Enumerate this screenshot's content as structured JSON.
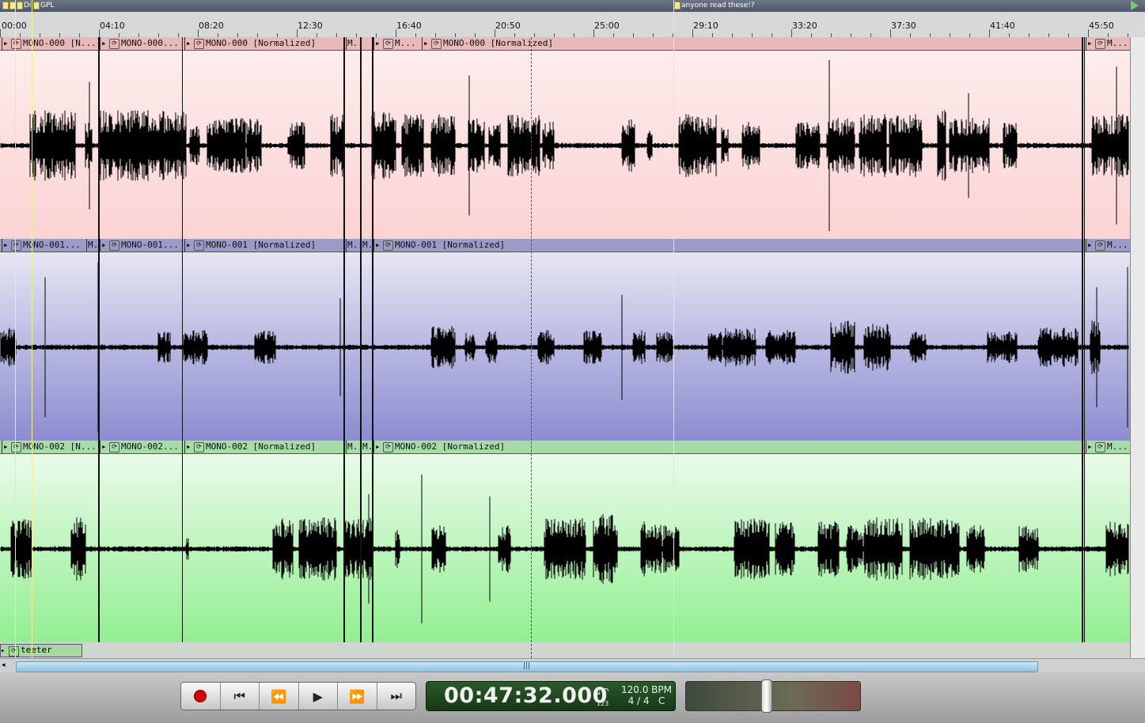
{
  "markers": [
    {
      "label": "Di"
    },
    {
      "label": "GPL"
    },
    {
      "label": "anyone read these!?"
    }
  ],
  "ruler": {
    "ticks": [
      "00:00",
      "04:10",
      "08:20",
      "12:30",
      "16:40",
      "20:50",
      "25:00",
      "29:10",
      "33:20",
      "37:30",
      "41:40",
      "45:50"
    ]
  },
  "tracks": [
    {
      "name": "MONO-000",
      "color_top": "#fdeeee",
      "color_bottom": "#fcd3d3",
      "bar_color": "#e9b8b8",
      "regions": [
        "MONO-000 [N...",
        "MONO-000...",
        "MONO-000 [Normalized]",
        "M...",
        "M...",
        "MONO-000 [Normalized]",
        "M..."
      ]
    },
    {
      "name": "MONO-001",
      "color_top": "#ececf6",
      "color_bottom": "#8c8cd0",
      "bar_color": "#9b9bc8",
      "regions": [
        "MONO-001...",
        "M...",
        "MONO-001...",
        "MONO-001 [Normalized]",
        "M...",
        "M...",
        "MONO-001 [Normalized]",
        "M..."
      ]
    },
    {
      "name": "MONO-002",
      "color_top": "#f0fbf0",
      "color_bottom": "#92ef92",
      "bar_color": "#a7dca7",
      "regions": [
        "MONO-002 [N...",
        "MONO-002...",
        "MONO-002 [Normalized]",
        "M...",
        "M...",
        "MONO-002 [Normalized]",
        "M..."
      ]
    }
  ],
  "extra_track": {
    "region": "teeter"
  },
  "transport": {
    "buttons": [
      {
        "name": "record",
        "icon": "record-icon"
      },
      {
        "name": "go-to-start",
        "icon": "skip-back-icon",
        "glyph": "⏮"
      },
      {
        "name": "rewind",
        "icon": "rewind-icon",
        "glyph": "⏪"
      },
      {
        "name": "play",
        "icon": "play-icon",
        "glyph": "▶"
      },
      {
        "name": "fast-forward",
        "icon": "fast-forward-icon",
        "glyph": "⏩"
      },
      {
        "name": "go-to-end",
        "icon": "skip-forward-icon",
        "glyph": "⏭"
      }
    ],
    "clock": "00:47:32.000",
    "bpm": "120.0 BPM",
    "meter": "4 / 4",
    "key": "C",
    "metronome_label": "123"
  },
  "colors": {
    "marker_flag": "#f2ea8c",
    "clock_bg": "#1f4a1f",
    "record": "#d40000",
    "scroll_thumb": "#8fc0dd"
  }
}
